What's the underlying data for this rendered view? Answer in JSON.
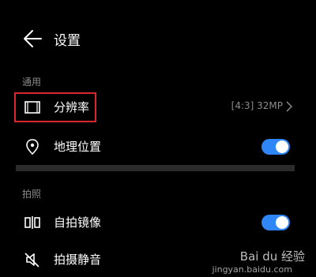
{
  "header": {
    "title": "设置"
  },
  "sections": {
    "general": "通用",
    "photo": "拍照"
  },
  "rows": {
    "resolution": {
      "label": "分辨率",
      "value": "[4:3] 32MP"
    },
    "location": {
      "label": "地理位置",
      "toggle": "on"
    },
    "mirror": {
      "label": "自拍镜像",
      "toggle": "on"
    },
    "mute": {
      "label": "拍摄静音"
    }
  },
  "colors": {
    "accent": "#2f86f6",
    "highlight": "#d9262c",
    "background": "#000000"
  },
  "watermark": {
    "main": "Bai du 经验",
    "sub": "jingyan.baidu.com"
  }
}
